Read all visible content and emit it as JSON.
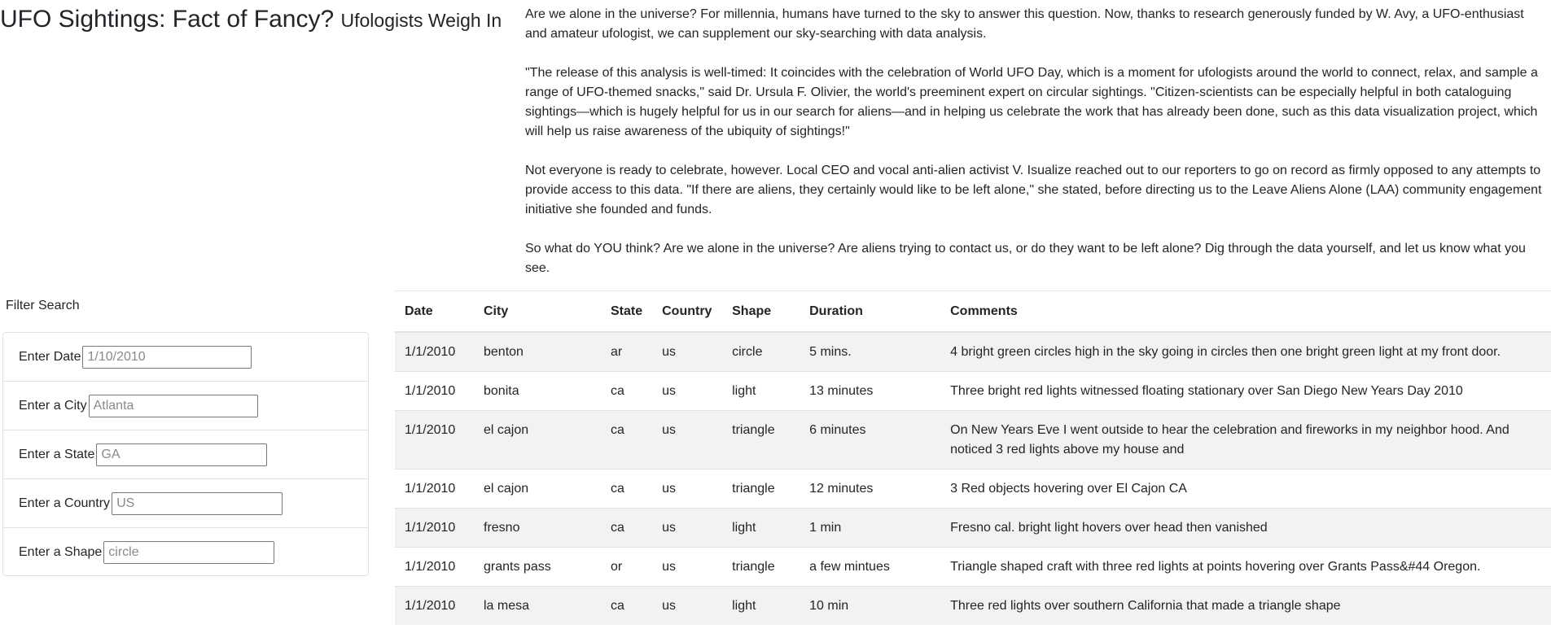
{
  "header": {
    "title": "UFO Sightings: Fact of Fancy?",
    "subtitle": "Ufologists Weigh In"
  },
  "article": {
    "paragraphs": [
      "Are we alone in the universe? For millennia, humans have turned to the sky to answer this question. Now, thanks to research generously funded by W. Avy, a UFO-enthusiast and amateur ufologist, we can supplement our sky-searching with data analysis.",
      "\"The release of this analysis is well-timed: It coincides with the celebration of World UFO Day, which is a moment for ufologists around the world to connect, relax, and sample a range of UFO-themed snacks,\" said Dr. Ursula F. Olivier, the world's preeminent expert on circular sightings. \"Citizen-scientists can be especially helpful in both cataloguing sightings—which is hugely helpful for us in our search for aliens—and in helping us celebrate the work that has already been done, such as this data visualization project, which will help us raise awareness of the ubiquity of sightings!\"",
      "Not everyone is ready to celebrate, however. Local CEO and vocal anti-alien activist V. Isualize reached out to our reporters to go on record as firmly opposed to any attempts to provide access to this data. \"If there are aliens, they certainly would like to be left alone,\" she stated, before directing us to the Leave Aliens Alone (LAA) community engagement initiative she founded and funds.",
      "So what do YOU think? Are we alone in the universe? Are aliens trying to contact us, or do they want to be left alone? Dig through the data yourself, and let us know what you see."
    ]
  },
  "filters": {
    "heading": "Filter Search",
    "items": [
      {
        "label": "Enter Date",
        "placeholder": "1/10/2010"
      },
      {
        "label": "Enter a City",
        "placeholder": "Atlanta"
      },
      {
        "label": "Enter a State",
        "placeholder": "GA"
      },
      {
        "label": "Enter a Country",
        "placeholder": "US"
      },
      {
        "label": "Enter a Shape",
        "placeholder": "circle"
      }
    ]
  },
  "table": {
    "headers": [
      "Date",
      "City",
      "State",
      "Country",
      "Shape",
      "Duration",
      "Comments"
    ],
    "rows": [
      [
        "1/1/2010",
        "benton",
        "ar",
        "us",
        "circle",
        "5 mins.",
        "4 bright green circles high in the sky going in circles then one bright green light at my front door."
      ],
      [
        "1/1/2010",
        "bonita",
        "ca",
        "us",
        "light",
        "13 minutes",
        "Three bright red lights witnessed floating stationary over San Diego New Years Day 2010"
      ],
      [
        "1/1/2010",
        "el cajon",
        "ca",
        "us",
        "triangle",
        "6 minutes",
        "On New Years Eve I went outside to hear the celebration and fireworks in my neighbor hood. And noticed 3 red lights above my house and"
      ],
      [
        "1/1/2010",
        "el cajon",
        "ca",
        "us",
        "triangle",
        "12 minutes",
        "3 Red objects hovering over El Cajon CA"
      ],
      [
        "1/1/2010",
        "fresno",
        "ca",
        "us",
        "light",
        "1 min",
        "Fresno cal. bright light hovers over head then vanished"
      ],
      [
        "1/1/2010",
        "grants pass",
        "or",
        "us",
        "triangle",
        "a few mintues",
        "Triangle shaped craft with three red lights at points hovering over Grants Pass&#44 Oregon."
      ],
      [
        "1/1/2010",
        "la mesa",
        "ca",
        "us",
        "light",
        "10 min",
        "Three red lights over southern California that made a triangle shape"
      ]
    ]
  }
}
